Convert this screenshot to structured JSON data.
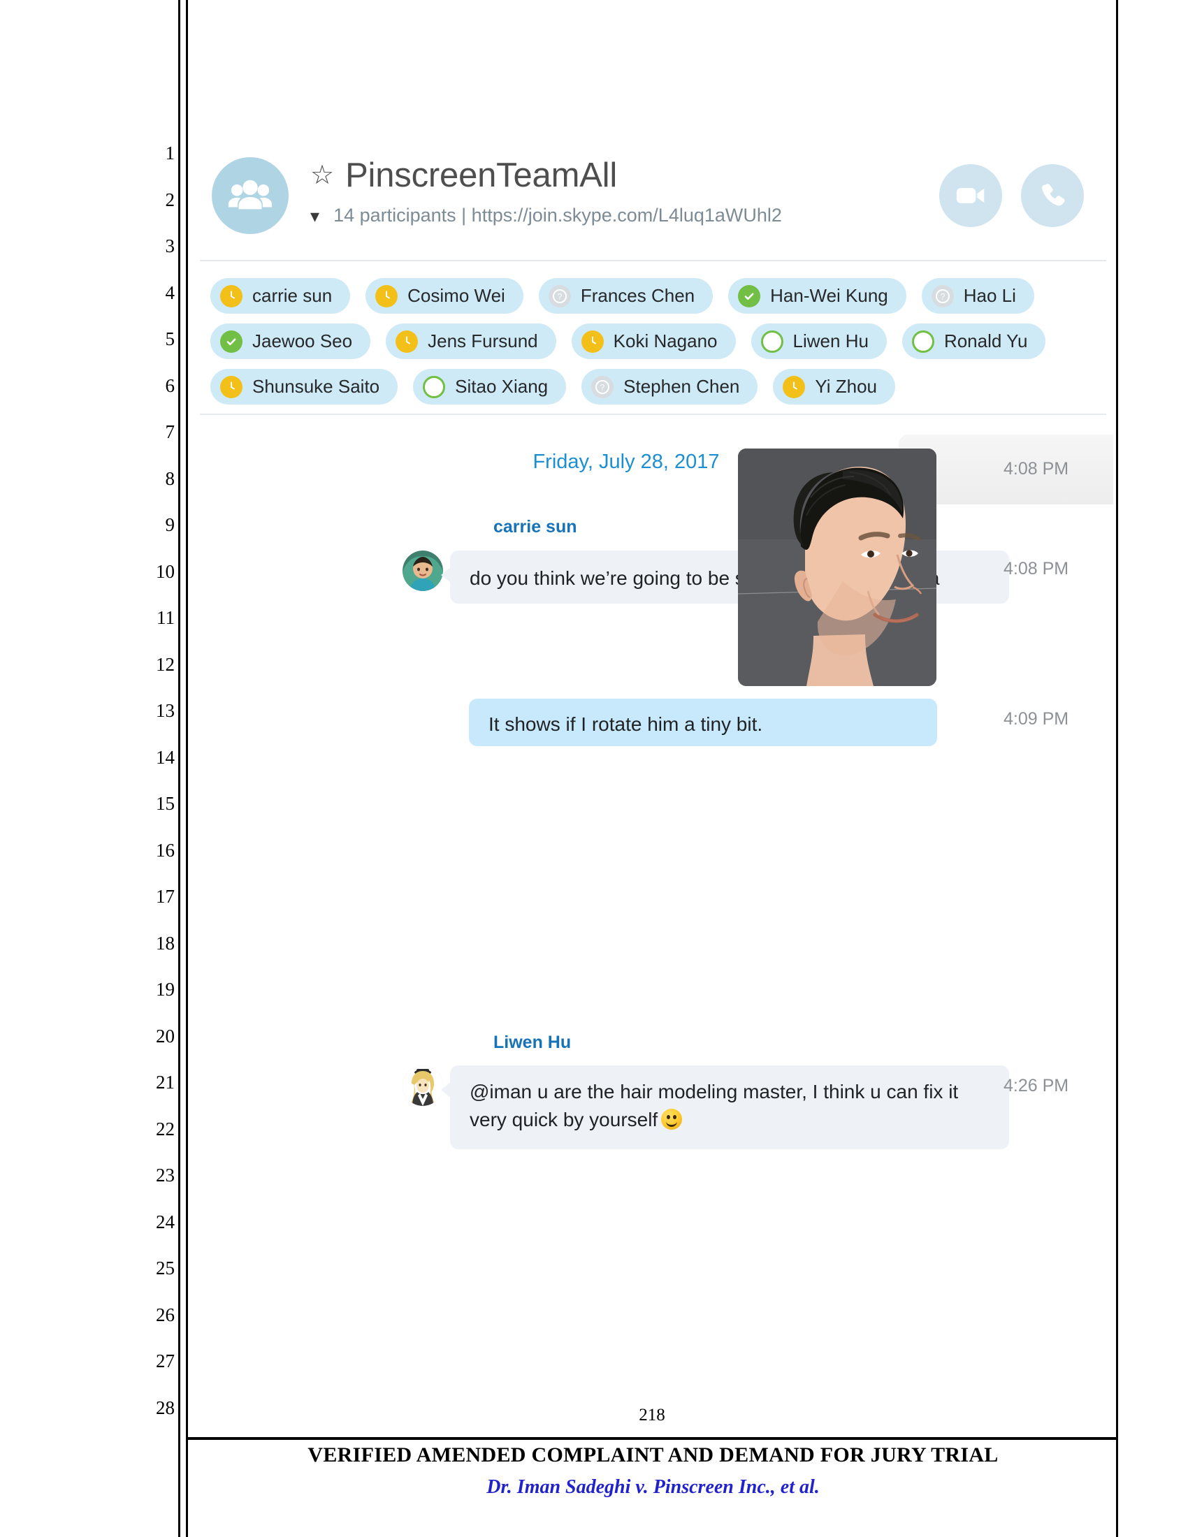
{
  "document": {
    "page_number": "218",
    "footer_title": "VERIFIED AMENDED COMPLAINT AND DEMAND FOR JURY TRIAL",
    "footer_subtitle": "Dr. Iman Sadeghi v. Pinscreen Inc., et al.",
    "line_numbers": [
      "1",
      "2",
      "3",
      "4",
      "5",
      "6",
      "7",
      "8",
      "9",
      "10",
      "11",
      "12",
      "13",
      "14",
      "15",
      "16",
      "17",
      "18",
      "19",
      "20",
      "21",
      "22",
      "23",
      "24",
      "25",
      "26",
      "27",
      "28"
    ]
  },
  "colors": {
    "accent_blue": "#1b8fd1",
    "sender_blue": "#1673b8",
    "chip_background": "#cfeaf7",
    "incoming_bubble": "#eef1f5",
    "outgoing_bubble": "#c7e9fb",
    "avatar_background": "#afd5e4",
    "status_away": "#f3c01a",
    "status_online": "#71bf44",
    "status_unknown": "#d7dce0"
  },
  "chat": {
    "header": {
      "group_avatar_icon": "people-group-icon",
      "favorite_icon": "star-icon",
      "title": "PinscreenTeamAll",
      "expand_icon": "chevron-down-icon",
      "participant_count": "14 participants",
      "separator": "|",
      "join_url": "https://join.skype.com/L4luq1aWUhl2",
      "subtitle": "14 participants  |  https://join.skype.com/L4luq1aWUhl2",
      "video_call_icon": "video-camera-icon",
      "audio_call_icon": "phone-icon"
    },
    "participants": [
      [
        {
          "name": "carrie sun",
          "status": "away",
          "icon": "clock-icon"
        },
        {
          "name": "Cosimo Wei",
          "status": "away",
          "icon": "clock-icon"
        },
        {
          "name": "Frances Chen",
          "status": "unknown",
          "icon": "question-mark-icon"
        },
        {
          "name": "Han-Wei Kung",
          "status": "online",
          "icon": "check-icon"
        },
        {
          "name": "Hao Li",
          "status": "unknown",
          "icon": "question-mark-icon"
        }
      ],
      [
        {
          "name": "Jaewoo Seo",
          "status": "online",
          "icon": "check-icon"
        },
        {
          "name": "Jens Fursund",
          "status": "away",
          "icon": "clock-icon"
        },
        {
          "name": "Koki Nagano",
          "status": "away",
          "icon": "clock-icon"
        },
        {
          "name": "Liwen Hu",
          "status": "ring",
          "icon": "ring-icon"
        },
        {
          "name": "Ronald Yu",
          "status": "ring",
          "icon": "ring-icon"
        }
      ],
      [
        {
          "name": "Shunsuke Saito",
          "status": "away",
          "icon": "clock-icon"
        },
        {
          "name": "Sitao Xiang",
          "status": "ring",
          "icon": "ring-icon"
        },
        {
          "name": "Stephen Chen",
          "status": "unknown",
          "icon": "question-mark-icon"
        },
        {
          "name": "Yi Zhou",
          "status": "away",
          "icon": "clock-icon"
        }
      ]
    ],
    "date_divider": "Friday, July 28, 2017",
    "messages": [
      {
        "sender": "carrie sun",
        "text": "do you think we’re going to be showing the sides? haa",
        "time": "4:08 PM",
        "direction": "incoming",
        "type": "text"
      },
      {
        "sender": "",
        "text": "",
        "time": "4:08 PM",
        "direction": "outgoing",
        "type": "image",
        "image_alt": "rendered 3d head of a smiling man with dark hair, three-quarter view"
      },
      {
        "sender": "",
        "text": "It shows if I rotate him a tiny bit.",
        "time": "4:09 PM",
        "direction": "outgoing",
        "type": "text"
      },
      {
        "sender": "Liwen Hu",
        "text_line1": "@iman u are the hair modeling master, I think u can fix it",
        "text_line2": "very quick by yourself",
        "emoji": "smiling-face-emoji",
        "time": "4:26 PM",
        "direction": "incoming",
        "type": "text"
      }
    ]
  }
}
